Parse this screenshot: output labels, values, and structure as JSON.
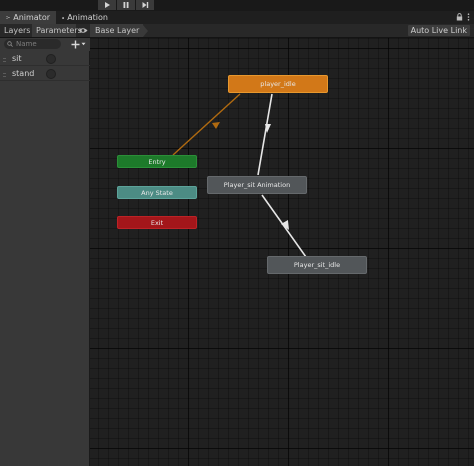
{
  "tabs": [
    {
      "label": "Animator",
      "icon": "animator-icon"
    },
    {
      "label": "Animation",
      "icon": "animation-clock-icon"
    }
  ],
  "header": {
    "layers_label": "Layers",
    "parameters_label": "Parameters",
    "breadcrumb": "Base Layer",
    "auto_live_link": "Auto Live Link"
  },
  "search": {
    "placeholder": "Name"
  },
  "parameters": [
    {
      "name": "sit",
      "type": "trigger"
    },
    {
      "name": "stand",
      "type": "trigger"
    }
  ],
  "states": {
    "default": "player_idle",
    "entry": "Entry",
    "any_state": "Any State",
    "exit": "Exit",
    "sit_animation": "Player_sit Animation",
    "sit_idle": "Player_sit_idle"
  },
  "colors": {
    "default_state": "#d27818",
    "entry": "#1d7a2a",
    "any_state": "#4c8c84",
    "exit": "#a3161a",
    "state": "#525659",
    "default_transition": "#b06a10",
    "transition": "#e6e6e6"
  }
}
